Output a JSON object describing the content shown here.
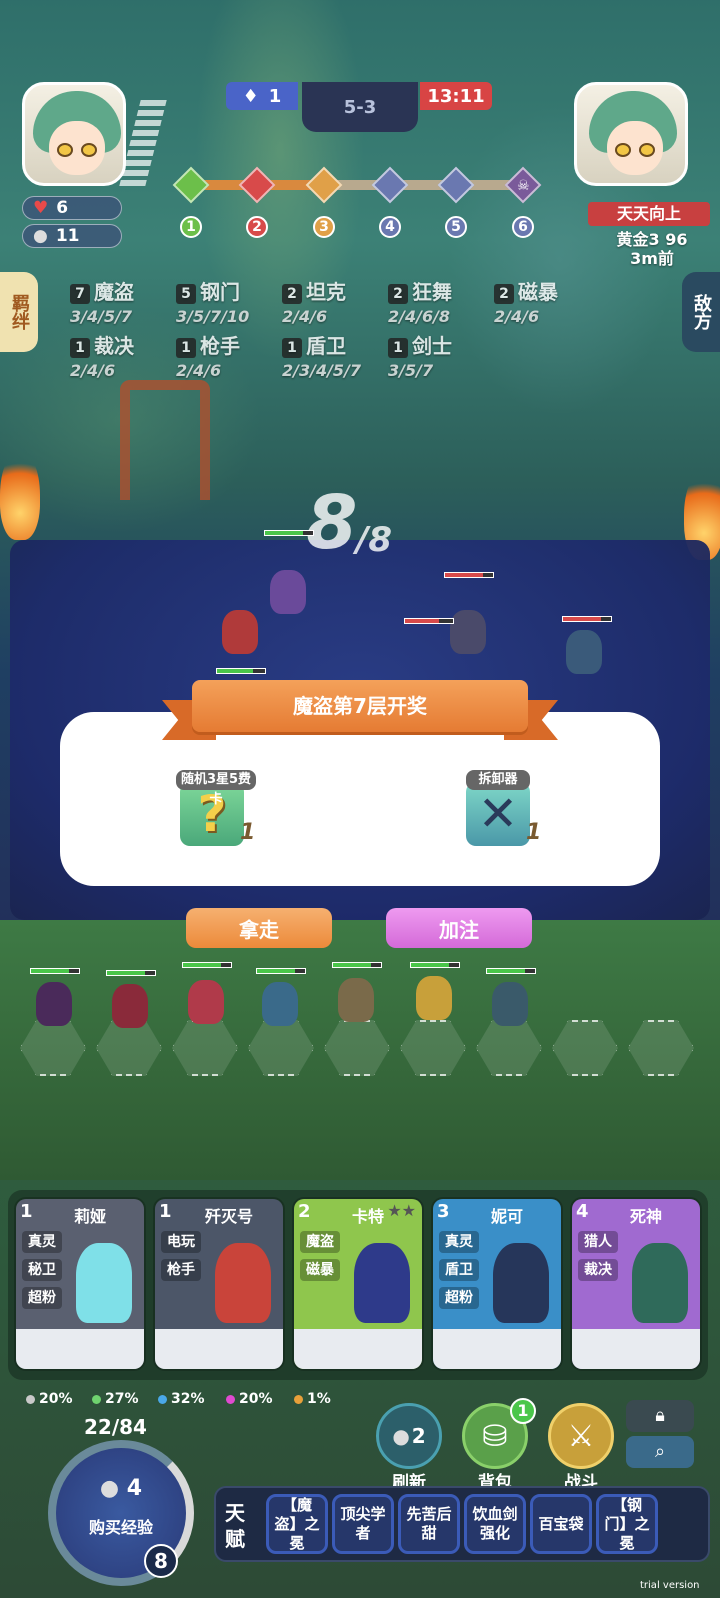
{
  "top": {
    "player_hearts": "6",
    "player_coins": "11",
    "blue_score": "1",
    "round": "5-3",
    "timer": "13:11",
    "stages": [
      "1",
      "2",
      "3",
      "4",
      "5",
      "6"
    ],
    "opponent_name": "天天向上",
    "opponent_gold": "黄金3 96",
    "opponent_time": "3m前"
  },
  "side_tabs": {
    "left": "羁绊",
    "right": "敌方"
  },
  "traits": [
    {
      "count": "7",
      "name": "魔盗",
      "tiers": "3/4/5/7"
    },
    {
      "count": "5",
      "name": "钢门",
      "tiers": "3/5/7/10"
    },
    {
      "count": "2",
      "name": "坦克",
      "tiers": "2/4/6"
    },
    {
      "count": "2",
      "name": "狂舞",
      "tiers": "2/4/6/8"
    },
    {
      "count": "2",
      "name": "磁暴",
      "tiers": "2/4/6"
    },
    {
      "count": "1",
      "name": "裁决",
      "tiers": "2/4/6"
    },
    {
      "count": "1",
      "name": "枪手",
      "tiers": "2/4/6"
    },
    {
      "count": "1",
      "name": "盾卫",
      "tiers": "2/3/4/5/7"
    },
    {
      "count": "1",
      "name": "剑士",
      "tiers": "3/5/7"
    }
  ],
  "board": {
    "count": "8",
    "max": "/8"
  },
  "reward": {
    "title": "魔盗第7层开奖",
    "items": [
      {
        "label": "随机3星5费卡",
        "glyph": "?",
        "count": "1",
        "icon": "question-icon"
      },
      {
        "label": "拆卸器",
        "glyph": "✕",
        "count": "1",
        "icon": "wrench-screwdriver-icon"
      }
    ],
    "take_label": "拿走",
    "bet_label": "加注"
  },
  "shop": [
    {
      "cost": "1",
      "name": "莉娅",
      "tags": [
        "真灵",
        "秘卫",
        "超粉"
      ],
      "color": "#5a6070",
      "char": "#7fe0e8"
    },
    {
      "cost": "1",
      "name": "歼灭号",
      "tags": [
        "电玩",
        "枪手"
      ],
      "color": "#4c5668",
      "char": "#c9443a"
    },
    {
      "cost": "2",
      "name": "卡特",
      "tags": [
        "魔盗",
        "磁暴"
      ],
      "color": "#8fc64d",
      "char": "#2e3a8a"
    },
    {
      "cost": "3",
      "name": "妮可",
      "tags": [
        "真灵",
        "盾卫",
        "超粉"
      ],
      "color": "#3a8fc8",
      "char": "#26365a"
    },
    {
      "cost": "4",
      "name": "死神",
      "tags": [
        "猎人",
        "裁决"
      ],
      "color": "#a06ad0",
      "char": "#2f6a5a"
    }
  ],
  "odds": [
    {
      "value": "20%",
      "color": "#c9c9c9"
    },
    {
      "value": "27%",
      "color": "#6fd36f"
    },
    {
      "value": "32%",
      "color": "#4aa8e8"
    },
    {
      "value": "20%",
      "color": "#e04ad0"
    },
    {
      "value": "1%",
      "color": "#e8a03a"
    }
  ],
  "xp": {
    "text": "22/84",
    "cost": "4",
    "label": "购买经验",
    "level": "8"
  },
  "actions": {
    "refresh_cost": "2",
    "refresh_label": "刷新",
    "bag_badge": "1",
    "bag_label": "背包",
    "fight_label": "战斗"
  },
  "talent_title": "天赋",
  "talents": [
    "【魔盗】之冕",
    "顶尖学者",
    "先苦后甜",
    "饮血剑强化",
    "百宝袋",
    "【钢门】之冕"
  ],
  "watermark": "trial version"
}
